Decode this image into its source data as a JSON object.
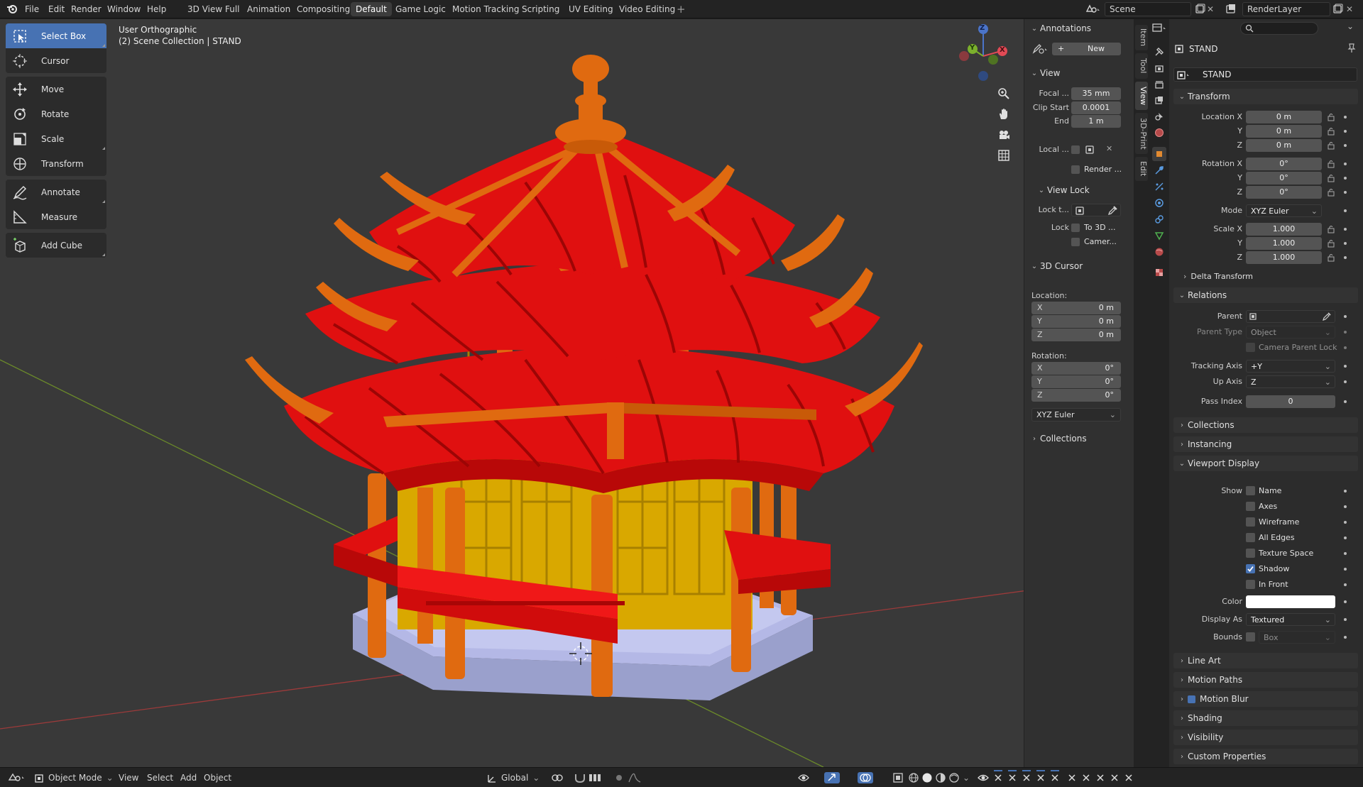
{
  "topbar": {
    "menus": [
      "File",
      "Edit",
      "Render",
      "Window",
      "Help"
    ],
    "workspaces": [
      "3D View Full",
      "Animation",
      "Compositing",
      "Default",
      "Game Logic",
      "Motion Tracking",
      "Scripting",
      "UV Editing",
      "Video Editing"
    ],
    "active_workspace": "Default",
    "add_tab": "+",
    "scene": "Scene",
    "view_layer": "RenderLayer"
  },
  "toolbar": {
    "tools": [
      "Select Box",
      "Cursor",
      "Move",
      "Rotate",
      "Scale",
      "Transform",
      "Annotate",
      "Measure",
      "Add Cube"
    ],
    "active": "Select Box"
  },
  "viewport": {
    "view_name": "User Orthographic",
    "collection_path": "(2) Scene Collection | STAND",
    "gizmo_axes": [
      "X",
      "Y",
      "Z"
    ]
  },
  "npanel": {
    "annotations_header": "Annotations",
    "new_button": "New",
    "view_header": "View",
    "focal_label": "Focal ...",
    "focal_value": "35 mm",
    "clip_start_label": "Clip Start",
    "clip_start_value": "0.0001",
    "end_label": "End",
    "end_value": "1 m",
    "local_label": "Local ...",
    "render_label": "Render ...",
    "view_lock_header": "View Lock",
    "lock_to_label": "Lock t...",
    "lock_label": "Lock",
    "to3d_label": "To 3D ...",
    "camera_label": "Camer...",
    "cursor_header": "3D Cursor",
    "location_label": "Location:",
    "loc": [
      {
        "axis": "X",
        "value": "0 m"
      },
      {
        "axis": "Y",
        "value": "0 m"
      },
      {
        "axis": "Z",
        "value": "0 m"
      }
    ],
    "rotation_label": "Rotation:",
    "rot": [
      {
        "axis": "X",
        "value": "0°"
      },
      {
        "axis": "Y",
        "value": "0°"
      },
      {
        "axis": "Z",
        "value": "0°"
      }
    ],
    "rotation_mode": "XYZ Euler",
    "collections_header": "Collections"
  },
  "sidetabs": [
    "Item",
    "Tool",
    "View",
    "3D-Print",
    "Edit"
  ],
  "sidetab_active": "View",
  "properties": {
    "object_name": "STAND",
    "data_name": "STAND",
    "transform_header": "Transform",
    "location_x_label": "Location X",
    "location": [
      "0 m",
      "0 m",
      "0 m"
    ],
    "rotation_x_label": "Rotation X",
    "rotation": [
      "0°",
      "0°",
      "0°"
    ],
    "y_label": "Y",
    "z_label": "Z",
    "mode_label": "Mode",
    "mode_value": "XYZ Euler",
    "scale_x_label": "Scale X",
    "scale": [
      "1.000",
      "1.000",
      "1.000"
    ],
    "delta_transform": "Delta Transform",
    "relations_header": "Relations",
    "parent_label": "Parent",
    "parent_type_label": "Parent Type",
    "parent_type_value": "Object",
    "camera_parent_lock": "Camera Parent Lock",
    "tracking_axis_label": "Tracking Axis",
    "tracking_axis_value": "+Y",
    "up_axis_label": "Up Axis",
    "up_axis_value": "Z",
    "pass_index_label": "Pass Index",
    "pass_index_value": "0",
    "collections": "Collections",
    "instancing": "Instancing",
    "viewport_display_header": "Viewport Display",
    "show_label": "Show",
    "show_options": [
      {
        "label": "Name",
        "checked": false
      },
      {
        "label": "Axes",
        "checked": false
      },
      {
        "label": "Wireframe",
        "checked": false
      },
      {
        "label": "All Edges",
        "checked": false
      },
      {
        "label": "Texture Space",
        "checked": false
      },
      {
        "label": "Shadow",
        "checked": true
      },
      {
        "label": "In Front",
        "checked": false
      }
    ],
    "color_label": "Color",
    "color_value": "#ffffff",
    "display_as_label": "Display As",
    "display_as_value": "Textured",
    "bounds_label": "Bounds",
    "bounds_value": "Box",
    "line_art": "Line Art",
    "motion_paths": "Motion Paths",
    "motion_blur": "Motion Blur",
    "shading": "Shading",
    "visibility": "Visibility",
    "custom_properties": "Custom Properties"
  },
  "statusbar": {
    "mode": "Object Mode",
    "menus": [
      "View",
      "Select",
      "Add",
      "Object"
    ],
    "orientation": "Global"
  },
  "colors": {
    "accent": "#4772b3",
    "roof_red": "#e01010",
    "eave_orange": "#e06a10",
    "wall_gold": "#d9a800",
    "base_lavender": "#b4b8e6"
  }
}
